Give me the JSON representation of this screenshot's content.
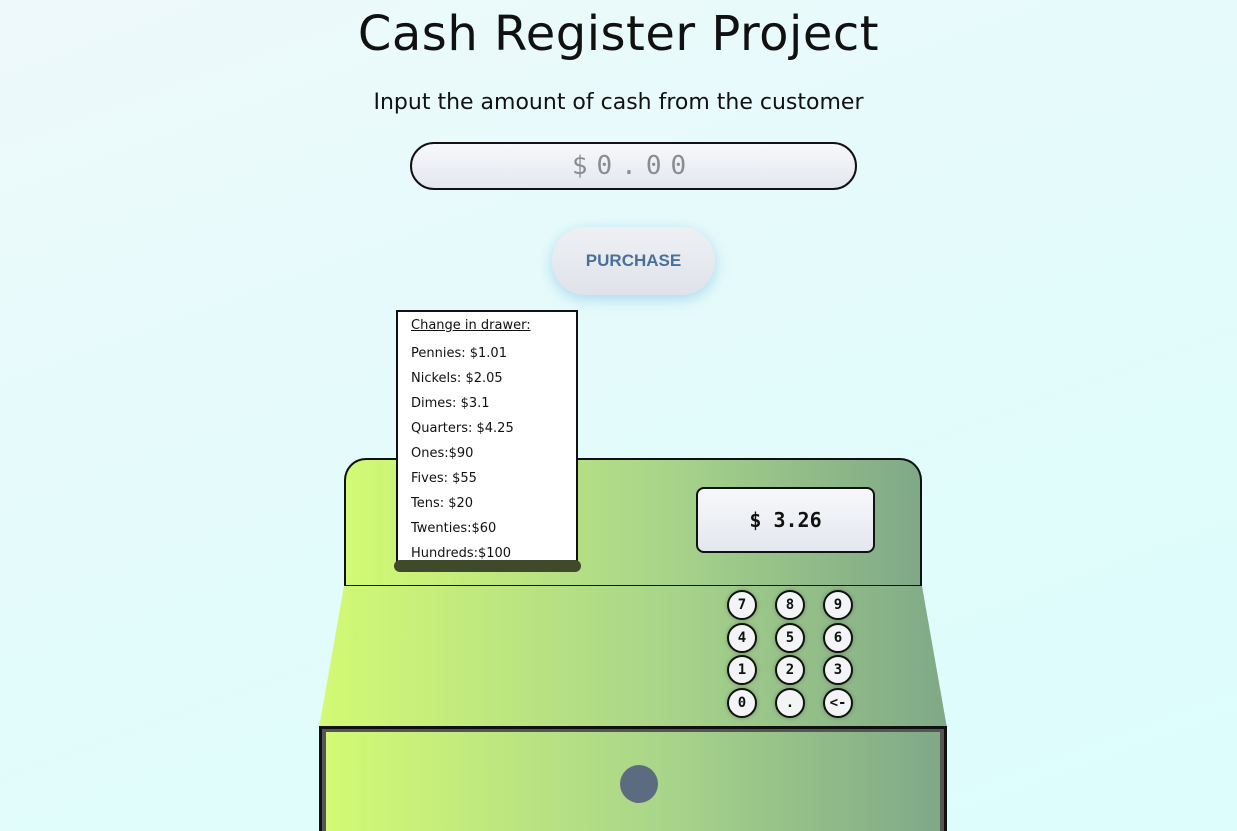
{
  "page": {
    "title": "Cash Register Project",
    "subtitle": "Input the amount of cash from the customer"
  },
  "cash_input": {
    "placeholder": "$0.00",
    "value": ""
  },
  "purchase_button": {
    "label": "PURCHASE"
  },
  "receipt": {
    "heading": "Change in drawer:",
    "lines": [
      "Pennies: $1.01",
      "Nickels: $2.05",
      "Dimes: $3.1",
      "Quarters: $4.25",
      "Ones:$90",
      "Fives: $55",
      "Tens: $20",
      "Twenties:$60",
      "Hundreds:$100"
    ]
  },
  "display": {
    "price": "$ 3.26"
  },
  "keypad": {
    "keys": [
      "7",
      "8",
      "9",
      "4",
      "5",
      "6",
      "1",
      "2",
      "3",
      "0",
      ".",
      "<-"
    ]
  },
  "colors": {
    "register_gradient_start": "#d3fa74",
    "register_gradient_end": "#7fa987",
    "button_text": "#4a6f9a",
    "drawer_knob": "#5d6b80"
  }
}
